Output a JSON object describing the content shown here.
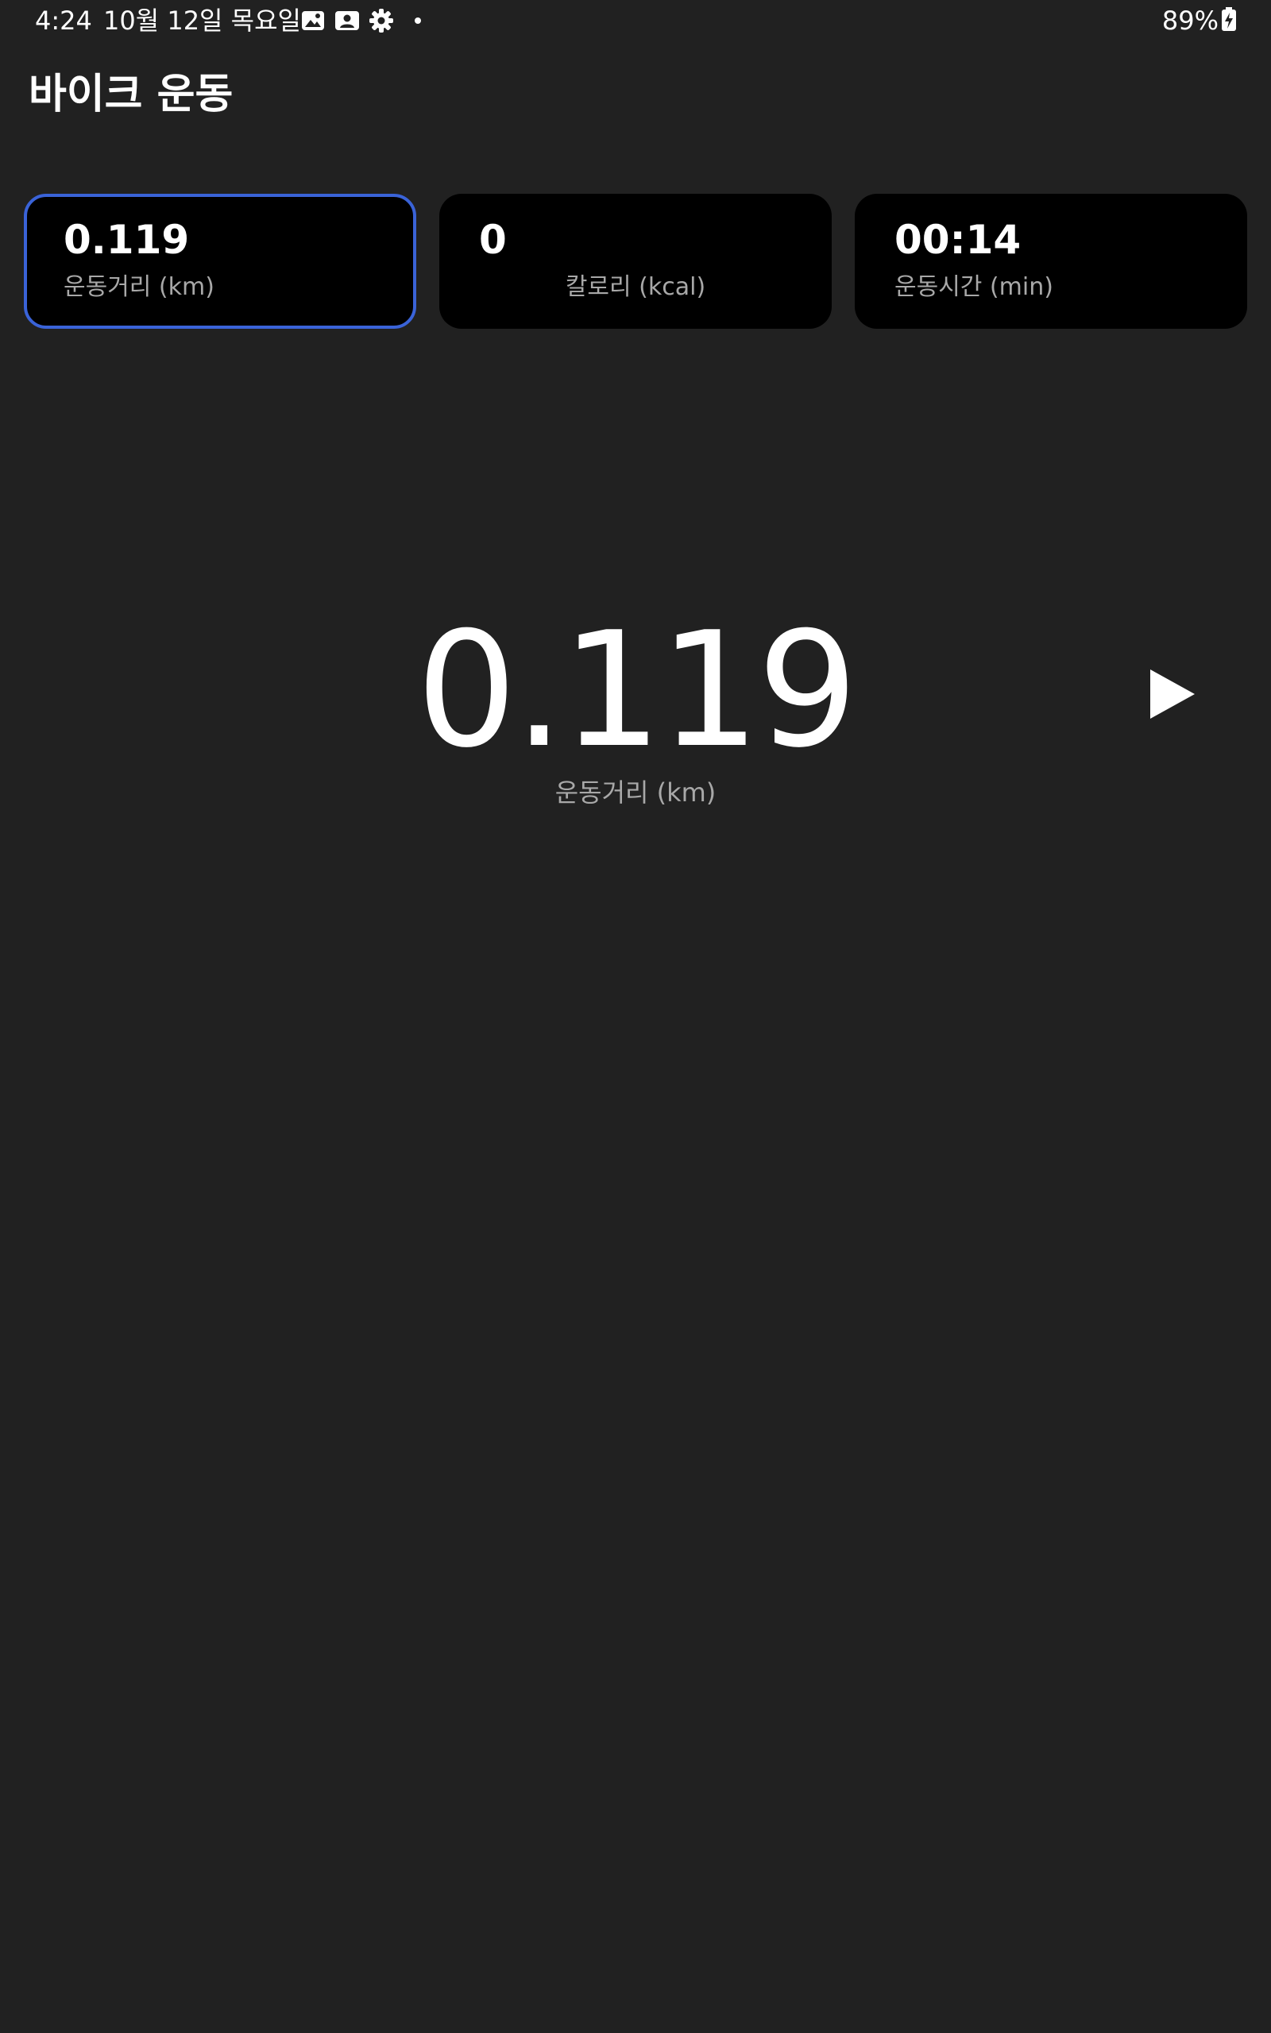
{
  "status_bar": {
    "time": "4:24",
    "date": "10월 12일 목요일",
    "icons": [
      "gallery-icon",
      "contact-card-icon",
      "settings-gear-icon",
      "notification-dot-icon"
    ],
    "battery": "89%",
    "battery_state": "charging"
  },
  "app_bar": {
    "title": "바이크 운동"
  },
  "metrics": [
    {
      "value": "0.119",
      "label": "운동거리 (km)",
      "selected": true
    },
    {
      "value": "0",
      "label": "칼로리 (kcal)",
      "selected": false
    },
    {
      "value": "00:14",
      "label": "운동시간 (min)",
      "selected": false
    }
  ],
  "main_display": {
    "value": "0.119",
    "label": "운동거리 (km)"
  },
  "controls": {
    "play_icon": "play-icon"
  },
  "colors": {
    "background": "#212121",
    "card_background": "#000000",
    "selected_border": "#3a63d8",
    "label_gray": "#a8a8a8",
    "text": "#ffffff"
  }
}
